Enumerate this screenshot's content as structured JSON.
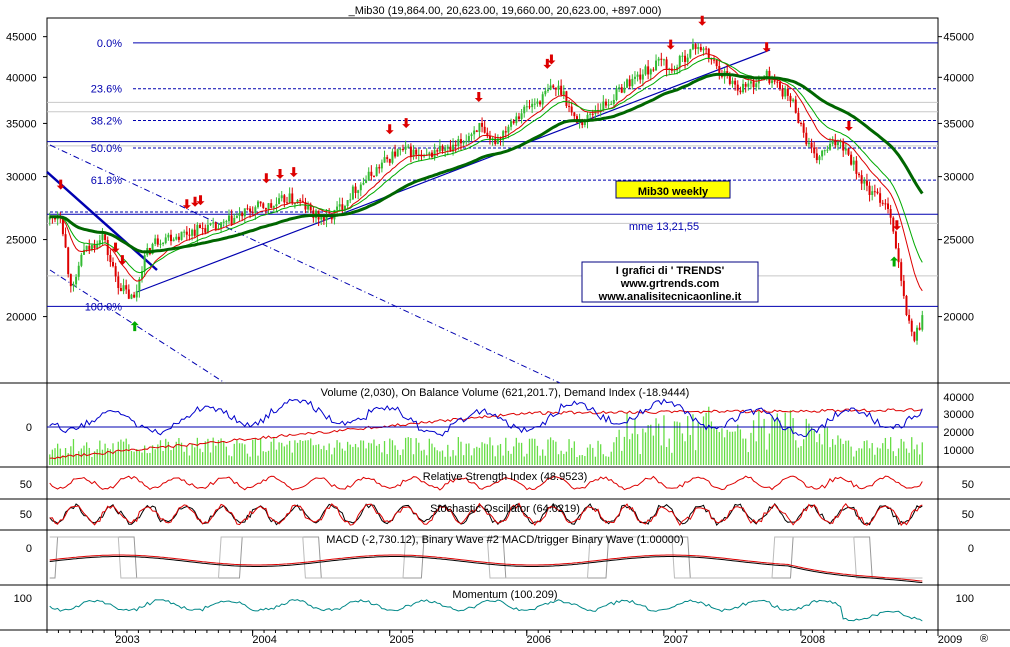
{
  "chart_data": [
    {
      "type": "candlestick",
      "title": "_Mib30 (19,864.00, 20,623.00, 19,660.00, 20,623.00, +897.000)",
      "y_ticks": [
        20000,
        25000,
        30000,
        35000,
        40000,
        45000
      ],
      "y_tick_labels": [
        "20000",
        "25000",
        "30000",
        "35000",
        "40000",
        "45000"
      ],
      "ylim": [
        16500,
        47500
      ],
      "log_scale": true,
      "x_labels": [
        "2003",
        "2004",
        "2005",
        "2006",
        "2007",
        "2008",
        "2009"
      ],
      "x_years": [
        2003,
        2004,
        2005,
        2006,
        2007,
        2008,
        2009
      ],
      "xlim": [
        2002.5,
        2009.0
      ],
      "close_path": [
        [
          2002.52,
          26500
        ],
        [
          2002.6,
          27000
        ],
        [
          2002.66,
          22500
        ],
        [
          2002.7,
          21500
        ],
        [
          2002.75,
          24000
        ],
        [
          2002.83,
          24500
        ],
        [
          2002.9,
          25500
        ],
        [
          2002.96,
          23500
        ],
        [
          2003.02,
          22000
        ],
        [
          2003.1,
          21200
        ],
        [
          2003.14,
          21000
        ],
        [
          2003.2,
          23500
        ],
        [
          2003.28,
          24800
        ],
        [
          2003.36,
          25200
        ],
        [
          2003.45,
          25300
        ],
        [
          2003.55,
          25600
        ],
        [
          2003.65,
          25900
        ],
        [
          2003.75,
          25800
        ],
        [
          2003.85,
          26500
        ],
        [
          2003.95,
          27000
        ],
        [
          2004.05,
          27500
        ],
        [
          2004.15,
          27500
        ],
        [
          2004.25,
          28200
        ],
        [
          2004.35,
          27800
        ],
        [
          2004.45,
          26800
        ],
        [
          2004.55,
          26500
        ],
        [
          2004.65,
          27600
        ],
        [
          2004.75,
          29000
        ],
        [
          2004.85,
          30000
        ],
        [
          2004.95,
          31200
        ],
        [
          2005.05,
          32200
        ],
        [
          2005.15,
          32300
        ],
        [
          2005.25,
          31500
        ],
        [
          2005.35,
          32500
        ],
        [
          2005.45,
          32300
        ],
        [
          2005.55,
          33500
        ],
        [
          2005.65,
          34800
        ],
        [
          2005.72,
          33000
        ],
        [
          2005.8,
          33600
        ],
        [
          2005.9,
          35600
        ],
        [
          2006.0,
          36600
        ],
        [
          2006.1,
          37500
        ],
        [
          2006.18,
          38800
        ],
        [
          2006.26,
          38600
        ],
        [
          2006.34,
          35500
        ],
        [
          2006.42,
          35200
        ],
        [
          2006.5,
          36500
        ],
        [
          2006.6,
          37200
        ],
        [
          2006.7,
          39000
        ],
        [
          2006.8,
          40000
        ],
        [
          2006.9,
          41000
        ],
        [
          2007.0,
          42000
        ],
        [
          2007.05,
          40500
        ],
        [
          2007.15,
          42500
        ],
        [
          2007.25,
          44000
        ],
        [
          2007.35,
          42000
        ],
        [
          2007.45,
          40200
        ],
        [
          2007.55,
          38800
        ],
        [
          2007.65,
          39300
        ],
        [
          2007.75,
          40200
        ],
        [
          2007.85,
          38800
        ],
        [
          2007.95,
          37000
        ],
        [
          2008.02,
          34000
        ],
        [
          2008.1,
          31500
        ],
        [
          2008.2,
          32500
        ],
        [
          2008.28,
          33500
        ],
        [
          2008.35,
          32000
        ],
        [
          2008.45,
          29500
        ],
        [
          2008.52,
          28500
        ],
        [
          2008.6,
          28000
        ],
        [
          2008.65,
          27300
        ],
        [
          2008.7,
          24000
        ],
        [
          2008.74,
          21500
        ],
        [
          2008.78,
          19800
        ],
        [
          2008.82,
          18800
        ],
        [
          2008.86,
          19300
        ],
        [
          2008.9,
          20623
        ]
      ],
      "fibonacci": [
        {
          "label": "0.0%",
          "value": 44200
        },
        {
          "label": "23.6%",
          "value": 38700
        },
        {
          "label": "38.2%",
          "value": 35300
        },
        {
          "label": "50.0%",
          "value": 32600
        },
        {
          "label": "61.8%",
          "value": 29700
        },
        {
          "label": "100.0%",
          "value": 20600
        }
      ],
      "horizontal_lines": [
        44200,
        33200,
        26900,
        20600
      ],
      "annotations": {
        "title_box": "Mib30 weekly",
        "subtitle": "mme 13,21,55",
        "info_lines": [
          "I grafici di   ' TRENDS'",
          "www.grtrends.com",
          "www.analisitecnicaonline.it"
        ]
      },
      "sell_signals": [
        2002.6,
        2003.0,
        2003.05,
        2003.52,
        2003.58,
        2003.62,
        2004.1,
        2004.2,
        2004.3,
        2005.0,
        2005.12,
        2005.65,
        2006.15,
        2006.18,
        2007.05,
        2007.28,
        2007.75,
        2008.35,
        2008.7
      ],
      "buy_signals": [
        2003.14,
        2008.68
      ]
    },
    {
      "type": "volume",
      "label": "Volume (2,030), On Balance Volume (621,201.7), Demand Index (-18.9444)",
      "left_ticks": [
        "0"
      ],
      "right_ticks": [
        "40000",
        "30000",
        "20000",
        "10000"
      ]
    },
    {
      "type": "line",
      "label": "Relative Strength Index (48.9523)",
      "left_ticks": [
        "50"
      ],
      "right_ticks": [
        "50"
      ]
    },
    {
      "type": "line",
      "label": "Stochastic Oscillator (64.0219)",
      "left_ticks": [
        "50"
      ],
      "right_ticks": [
        "50"
      ]
    },
    {
      "type": "line",
      "label": "MACD (-2,730.12), Binary Wave #2 MACD/trigger Binary Wave (1.00000)",
      "left_ticks": [
        "0"
      ],
      "right_ticks": [
        "0"
      ]
    },
    {
      "type": "line",
      "label": "Momentum (100.209)",
      "left_ticks": [
        "100"
      ],
      "right_ticks": [
        "100"
      ]
    }
  ],
  "colors": {
    "sell_arrow": "#dd0000",
    "buy_arrow": "#00aa00",
    "candle_up": "#33bb33",
    "candle_down": "#dd0000",
    "trend_line": "#0000b0",
    "ma55": "#006600",
    "ma13": "#dd0000",
    "ma21": "#00aa00",
    "title_box_bg": "#ffff00",
    "info_text": "#000080"
  },
  "footer_mark": "®"
}
